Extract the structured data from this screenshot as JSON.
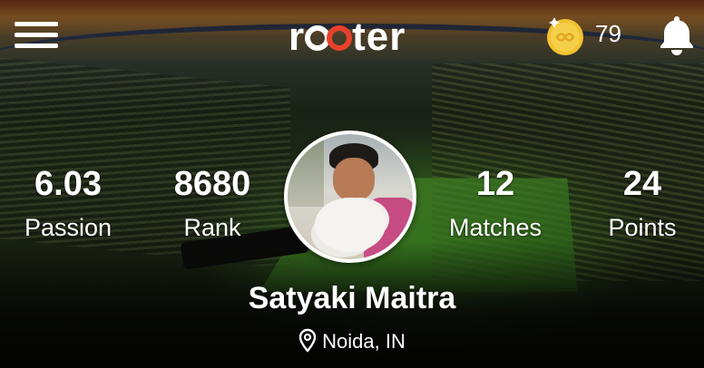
{
  "header": {
    "logo_text": "rooter",
    "menu_icon": "hamburger-menu-icon",
    "coin_icon": "coin-icon",
    "coin_count": "79",
    "notification_icon": "bell-icon"
  },
  "profile": {
    "name": "Satyaki Maitra",
    "location": "Noida, IN",
    "location_icon": "location-pin-icon",
    "stats": [
      {
        "value": "6.03",
        "label": "Passion"
      },
      {
        "value": "8680",
        "label": "Rank"
      },
      {
        "value": "12",
        "label": "Matches"
      },
      {
        "value": "24",
        "label": "Points"
      }
    ]
  },
  "colors": {
    "coin_gold": "#f2c230",
    "logo_accent": "#e8412c",
    "text": "#ffffff"
  }
}
